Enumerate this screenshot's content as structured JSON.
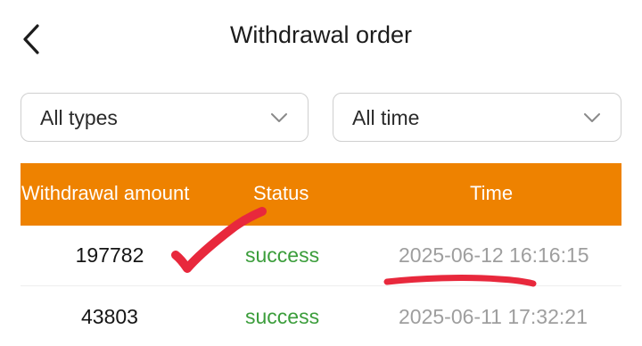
{
  "header": {
    "back_icon": "chevron-left-icon",
    "title": "Withdrawal order"
  },
  "filters": {
    "type": {
      "selected": "All types",
      "icon": "chevron-down-icon"
    },
    "time": {
      "selected": "All time",
      "icon": "chevron-down-icon"
    }
  },
  "table": {
    "columns": [
      "Withdrawal amount",
      "Status",
      "Time"
    ],
    "rows": [
      {
        "amount": "197782",
        "status": "success",
        "time": "2025-06-12 16:16:15"
      },
      {
        "amount": "43803",
        "status": "success",
        "time": "2025-06-11 17:32:21"
      }
    ]
  },
  "colors": {
    "header_bg": "#ee8200",
    "status_success": "#3b9d3b",
    "time_text": "#9e9e9e",
    "annotation_red": "#e8283c"
  },
  "annotations": {
    "check_mark": "red-check-mark",
    "underline": "red-underline"
  }
}
